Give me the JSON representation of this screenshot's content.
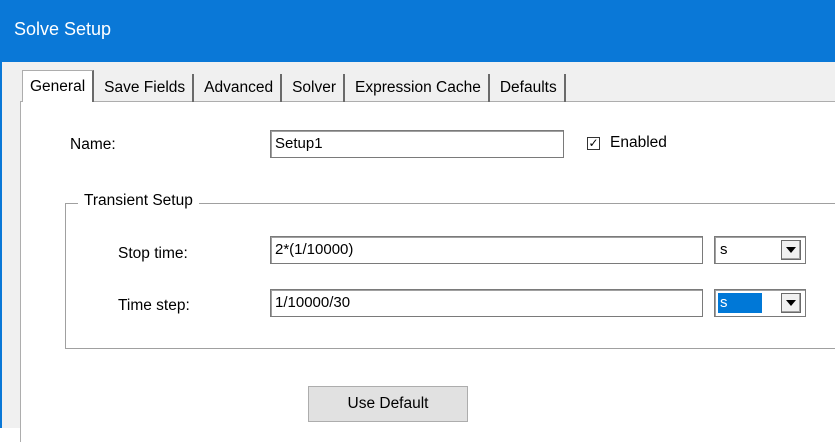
{
  "window": {
    "title": "Solve Setup"
  },
  "tabs": [
    {
      "label": "General",
      "active": true
    },
    {
      "label": "Save Fields",
      "active": false
    },
    {
      "label": "Advanced",
      "active": false
    },
    {
      "label": "Solver",
      "active": false
    },
    {
      "label": "Expression Cache",
      "active": false
    },
    {
      "label": "Defaults",
      "active": false
    }
  ],
  "general": {
    "name_label": "Name:",
    "name_value": "Setup1",
    "enabled_label": "Enabled",
    "enabled_checked": true,
    "check_glyph": "✓"
  },
  "transient": {
    "group_title": "Transient Setup",
    "stop_time_label": "Stop time:",
    "stop_time_value": "2*(1/10000)",
    "stop_time_unit": "s",
    "time_step_label": "Time step:",
    "time_step_value": "1/10000/30",
    "time_step_unit": "s"
  },
  "actions": {
    "use_default_label": "Use Default"
  },
  "colors": {
    "titlebar": "#0a78d7",
    "selection": "#0078d7",
    "dialog_bg": "#f0f0f0"
  }
}
